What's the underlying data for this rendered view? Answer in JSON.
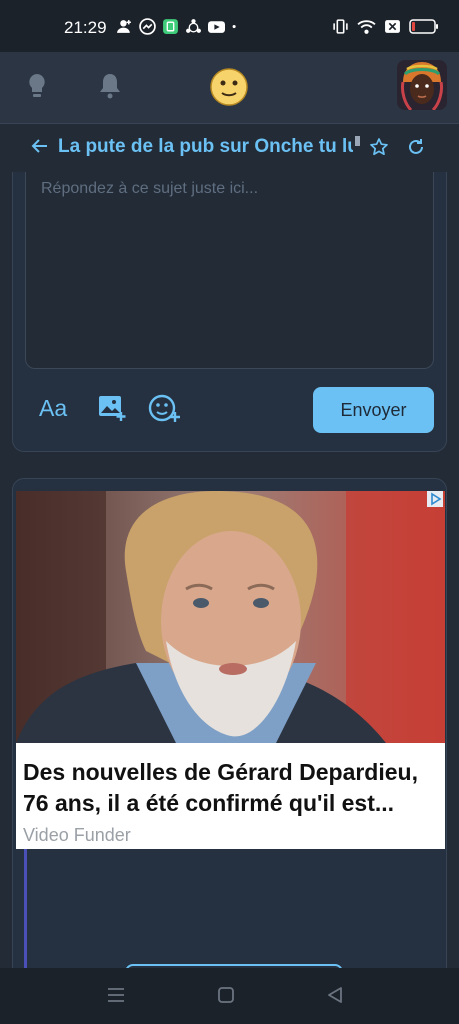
{
  "status_bar": {
    "time": "21:29",
    "left_icons": [
      "person-add-icon",
      "messenger-icon",
      "app-icon",
      "sync-icon",
      "youtube-icon",
      "dot-icon"
    ],
    "right_icons": [
      "vibrate-icon",
      "wifi-icon",
      "close-box-icon",
      "battery-icon"
    ],
    "battery_level": 0.15,
    "battery_color": "#e2473f"
  },
  "header": {
    "icons": [
      "lightbulb-icon",
      "bell-icon",
      "onche-smiley-logo",
      "avatar"
    ]
  },
  "topic": {
    "back_icon": "arrow-left-icon",
    "title": "La pute de la pub sur Onche tu lui",
    "actions": [
      "star-icon",
      "refresh-icon"
    ]
  },
  "reply": {
    "placeholder": "Répondez à ce sujet juste ici...",
    "font_tool_label": "Aa",
    "tools": [
      "text-format-icon",
      "add-image-icon",
      "add-emoji-icon"
    ],
    "send_label": "Envoyer"
  },
  "ad": {
    "headline": "Des nouvelles de Gérard Depardieu, 76 ans, il a été confirmé qu'il est...",
    "source": "Video Funder",
    "badge_icon": "ad-choices-icon"
  },
  "navigation": {
    "icons": [
      "menu-icon",
      "home-square-icon",
      "back-triangle-icon"
    ]
  },
  "colors": {
    "accent": "#6bc1f3",
    "background": "#222b36",
    "header": "#2b3543",
    "card": "#253040"
  }
}
